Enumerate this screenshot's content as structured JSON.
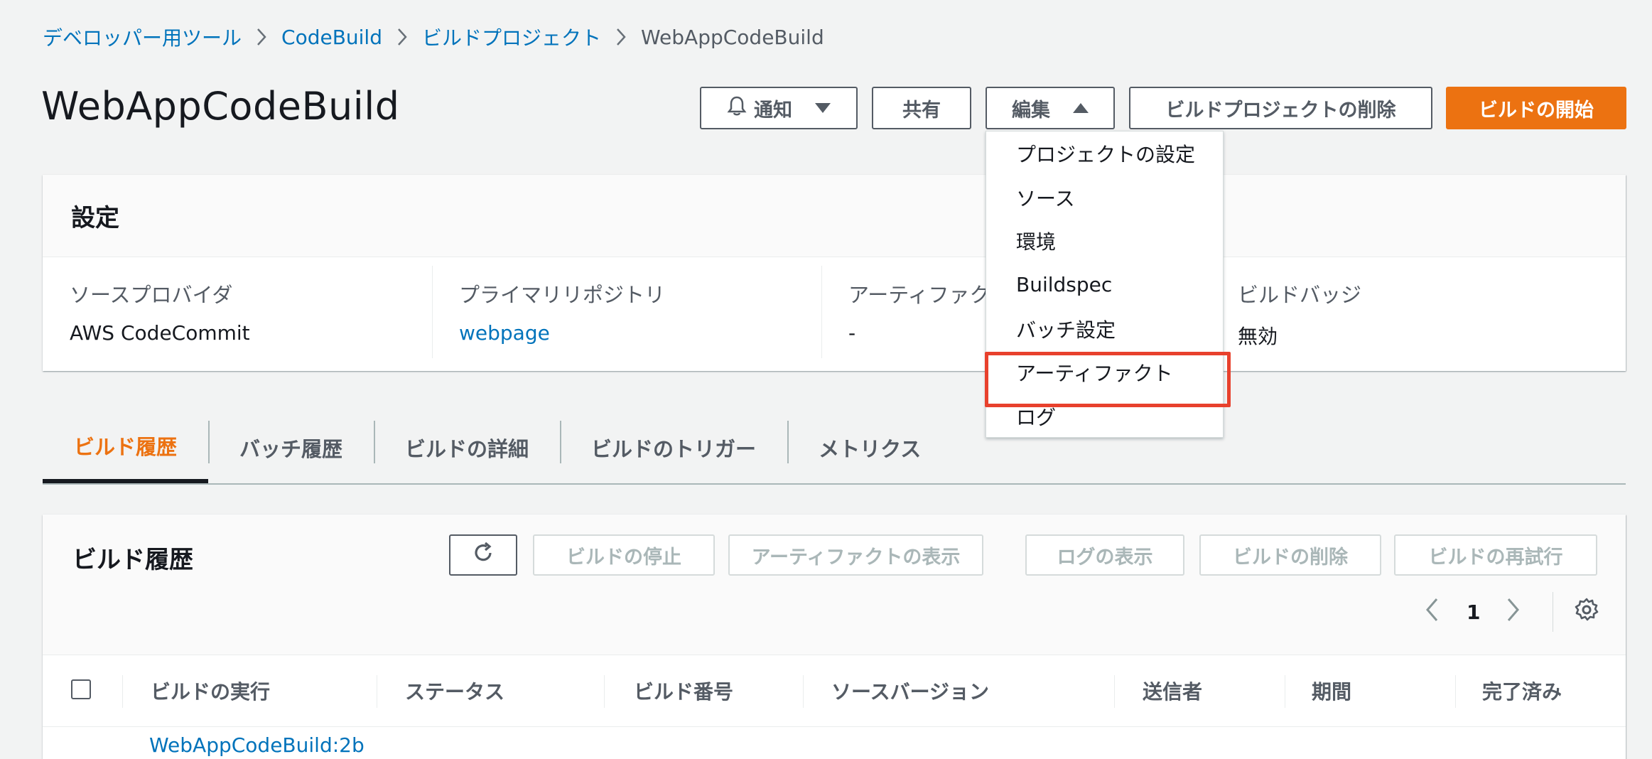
{
  "breadcrumb": {
    "items": [
      "デベロッパー用ツール",
      "CodeBuild",
      "ビルドプロジェクト"
    ],
    "current": "WebAppCodeBuild"
  },
  "page": {
    "title": "WebAppCodeBuild"
  },
  "header_buttons": {
    "notify": "通知",
    "share": "共有",
    "edit": "編集",
    "delete_project": "ビルドプロジェクトの削除",
    "start_build": "ビルドの開始"
  },
  "edit_menu": {
    "items": [
      "プロジェクトの設定",
      "ソース",
      "環境",
      "Buildspec",
      "バッチ設定",
      "アーティファクト",
      "ログ"
    ],
    "highlighted": "アーティファクト"
  },
  "settings": {
    "title": "設定",
    "fields": [
      {
        "label": "ソースプロバイダ",
        "value": "AWS CodeCommit"
      },
      {
        "label": "プライマリリポジトリ",
        "value": "webpage"
      },
      {
        "label": "アーティファクト",
        "value": "-"
      },
      {
        "label": "ビルドバッジ",
        "value": "無効"
      }
    ]
  },
  "tabs": [
    "ビルド履歴",
    "バッチ履歴",
    "ビルドの詳細",
    "ビルドのトリガー",
    "メトリクス"
  ],
  "history": {
    "title": "ビルド履歴",
    "buttons": [
      "ビルドの停止",
      "アーティファクトの表示",
      "ログの表示",
      "ビルドの削除",
      "ビルドの再試行"
    ],
    "page": "1",
    "columns": [
      "ビルドの実行",
      "ステータス",
      "ビルド番号",
      "ソースバージョン",
      "送信者",
      "期間",
      "完了済み"
    ],
    "rows": [
      {
        "build_run": "WebAppCodeBuild:2b"
      }
    ]
  },
  "colors": {
    "primary": "#ec7211",
    "link": "#0073bb",
    "highlight": "#e8412d"
  }
}
